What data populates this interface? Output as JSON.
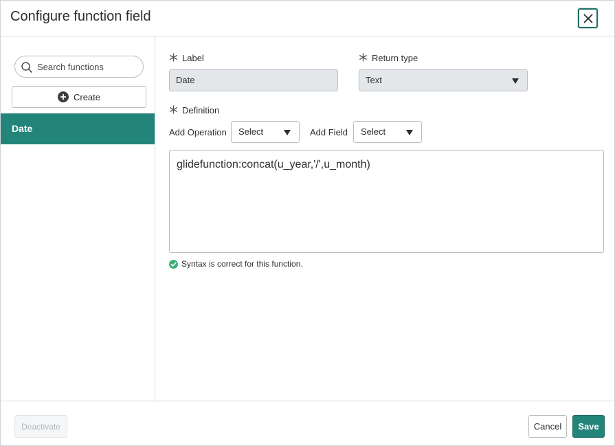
{
  "dialog": {
    "title": "Configure function field",
    "close_icon": "close-icon"
  },
  "sidebar": {
    "search_placeholder": "Search functions",
    "search_value": "",
    "create_label": "Create",
    "items": [
      {
        "label": "Date",
        "selected": true
      }
    ]
  },
  "form": {
    "label_title": "Label",
    "label_value": "Date",
    "return_type_title": "Return type",
    "return_type_value": "Text",
    "definition_title": "Definition",
    "add_operation_label": "Add Operation",
    "add_operation_value": "Select",
    "add_field_label": "Add Field",
    "add_field_value": "Select",
    "definition_value": "glidefunction:concat(u_year,'/',u_month)",
    "status_text": "Syntax is correct for this function."
  },
  "footer": {
    "deactivate_label": "Deactivate",
    "cancel_label": "Cancel",
    "save_label": "Save"
  },
  "colors": {
    "accent": "#23857a",
    "accent_dark": "#1f6f66",
    "success": "#3fae7a"
  }
}
